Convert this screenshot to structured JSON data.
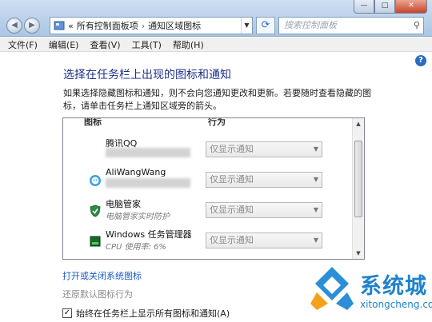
{
  "address": {
    "breadcrumb": [
      "所有控制面板项",
      "通知区域图标"
    ],
    "prefix": "«"
  },
  "search": {
    "placeholder": "搜索控制面板"
  },
  "window_buttons": {
    "min": "—",
    "max": "□",
    "close": "✕"
  },
  "menu": [
    "文件(F)",
    "编辑(E)",
    "查看(V)",
    "工具(T)",
    "帮助(H)"
  ],
  "page": {
    "title": "选择在任务栏上出现的图标和通知",
    "description": "如果选择隐藏图标和通知，则不会向您通知更改和更新。若要随时查看隐藏的图标，请单击任务栏上通知区域旁的箭头。"
  },
  "table": {
    "col_icon": "图标",
    "col_behavior": "行为",
    "rows": [
      {
        "name": "腾讯QQ",
        "sub": "",
        "behavior": "仅显示通知",
        "icon": "qq-icon"
      },
      {
        "name": "AliWangWang",
        "sub": "",
        "behavior": "仅显示通知",
        "icon": "aliwangwang-icon"
      },
      {
        "name": "电脑管家",
        "sub": "电脑管家实时防护",
        "behavior": "仅显示通知",
        "icon": "shield-icon"
      },
      {
        "name": "Windows 任务管理器",
        "sub": "CPU 使用率: 6%",
        "behavior": "仅显示通知",
        "icon": "task-manager-icon"
      }
    ]
  },
  "links": {
    "system_icons": "打开或关闭系统图标",
    "restore_defaults": "还原默认图标行为"
  },
  "checkbox": {
    "label": "始终在任务栏上显示所有图标和通知(A)",
    "checked": true
  },
  "watermark": {
    "title": "系统城",
    "url": "xitongcheng.com"
  },
  "colors": {
    "accent": "#1e3287",
    "link": "#1a5ac6",
    "watermark": "#1f82c9"
  }
}
